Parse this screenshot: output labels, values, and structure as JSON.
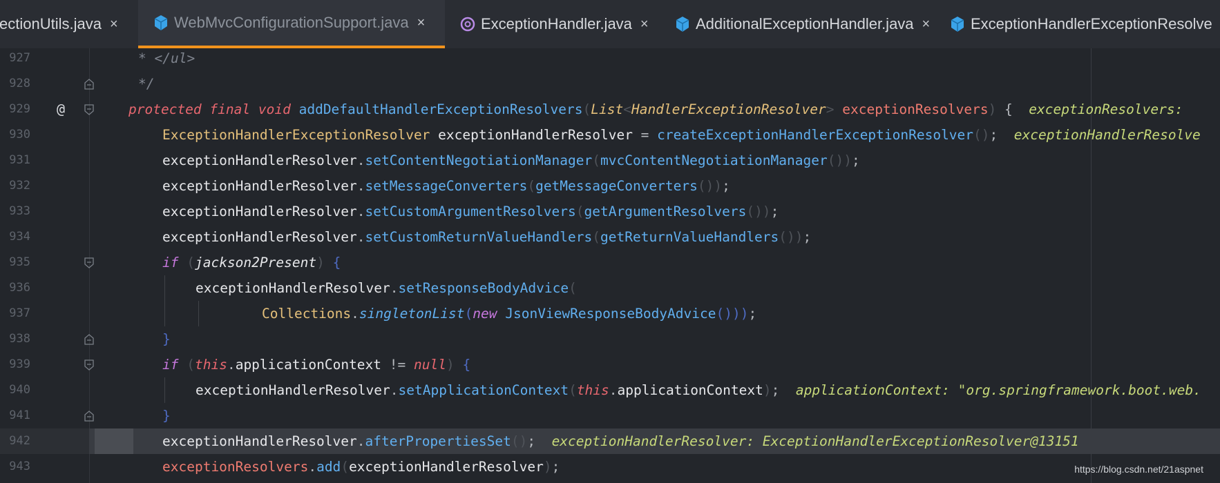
{
  "tabs": [
    {
      "label": "flectionUtils.java",
      "icon": "class-icon",
      "active": false,
      "close": "×"
    },
    {
      "label": "WebMvcConfigurationSupport.java",
      "icon": "class-icon",
      "active": true,
      "close": "×"
    },
    {
      "label": "ExceptionHandler.java",
      "icon": "annotation-icon",
      "active": false,
      "close": "×"
    },
    {
      "label": "AdditionalExceptionHandler.java",
      "icon": "class-icon",
      "active": false,
      "close": "×"
    },
    {
      "label": "ExceptionHandlerExceptionResolve",
      "icon": "class-icon",
      "active": false,
      "close": ""
    }
  ],
  "editor": {
    "lines": [
      {
        "num": "927",
        "tokens": [
          [
            "cm",
            "* </ul>"
          ]
        ]
      },
      {
        "num": "928",
        "tokens": [
          [
            "cm",
            "*/"
          ]
        ]
      },
      {
        "num": "929",
        "tokens": [
          [
            "kw",
            "protected"
          ],
          [
            "punc",
            " "
          ],
          [
            "kw",
            "final"
          ],
          [
            "punc",
            " "
          ],
          [
            "kw",
            "void"
          ],
          [
            "punc",
            " "
          ],
          [
            "fn",
            "addDefaultHandlerExceptionResolvers"
          ],
          [
            "paren",
            "("
          ],
          [
            "ty-it",
            "List"
          ],
          [
            "paren",
            "<"
          ],
          [
            "ty-it",
            "HandlerExceptionResolver"
          ],
          [
            "paren",
            ">"
          ],
          [
            "punc",
            " "
          ],
          [
            "param",
            "exceptionResolvers"
          ],
          [
            "paren",
            ")"
          ],
          [
            "punc",
            " {  "
          ],
          [
            "hint",
            "exceptionResolvers:"
          ]
        ]
      },
      {
        "num": "930",
        "tokens": [
          [
            "ty",
            "ExceptionHandlerExceptionResolver"
          ],
          [
            "punc",
            " "
          ],
          [
            "id",
            "exceptionHandlerResolver"
          ],
          [
            "punc",
            " = "
          ],
          [
            "fn",
            "createExceptionHandlerExceptionResolver"
          ],
          [
            "paren",
            "()"
          ],
          [
            "punc",
            ";  "
          ],
          [
            "hint",
            "exceptionHandlerResolve"
          ]
        ]
      },
      {
        "num": "931",
        "tokens": [
          [
            "id",
            "exceptionHandlerResolver"
          ],
          [
            "punc",
            "."
          ],
          [
            "fn",
            "setContentNegotiationManager"
          ],
          [
            "paren",
            "("
          ],
          [
            "fn",
            "mvcContentNegotiationManager"
          ],
          [
            "paren",
            "())"
          ],
          [
            "punc",
            ";"
          ]
        ]
      },
      {
        "num": "932",
        "tokens": [
          [
            "id",
            "exceptionHandlerResolver"
          ],
          [
            "punc",
            "."
          ],
          [
            "fn",
            "setMessageConverters"
          ],
          [
            "paren",
            "("
          ],
          [
            "fn",
            "getMessageConverters"
          ],
          [
            "paren",
            "())"
          ],
          [
            "punc",
            ";"
          ]
        ]
      },
      {
        "num": "933",
        "tokens": [
          [
            "id",
            "exceptionHandlerResolver"
          ],
          [
            "punc",
            "."
          ],
          [
            "fn",
            "setCustomArgumentResolvers"
          ],
          [
            "paren",
            "("
          ],
          [
            "fn",
            "getArgumentResolvers"
          ],
          [
            "paren",
            "())"
          ],
          [
            "punc",
            ";"
          ]
        ]
      },
      {
        "num": "934",
        "tokens": [
          [
            "id",
            "exceptionHandlerResolver"
          ],
          [
            "punc",
            "."
          ],
          [
            "fn",
            "setCustomReturnValueHandlers"
          ],
          [
            "paren",
            "("
          ],
          [
            "fn",
            "getReturnValueHandlers"
          ],
          [
            "paren",
            "())"
          ],
          [
            "punc",
            ";"
          ]
        ]
      },
      {
        "num": "935",
        "tokens": [
          [
            "kw2",
            "if"
          ],
          [
            "punc",
            " "
          ],
          [
            "paren",
            "("
          ],
          [
            "id-it",
            "jackson2Present"
          ],
          [
            "paren",
            ")"
          ],
          [
            "punc",
            " "
          ],
          [
            "paren-b",
            "{"
          ]
        ]
      },
      {
        "num": "936",
        "tokens": [
          [
            "id",
            "exceptionHandlerResolver"
          ],
          [
            "punc",
            "."
          ],
          [
            "fn",
            "setResponseBodyAdvice"
          ],
          [
            "paren",
            "("
          ]
        ]
      },
      {
        "num": "937",
        "tokens": [
          [
            "ty",
            "Collections"
          ],
          [
            "punc",
            "."
          ],
          [
            "fn-it",
            "singletonList"
          ],
          [
            "paren-b",
            "("
          ],
          [
            "kw2",
            "new"
          ],
          [
            "punc",
            " "
          ],
          [
            "fn",
            "JsonViewResponseBodyAdvice"
          ],
          [
            "paren-b",
            "()))"
          ],
          [
            "punc",
            ";"
          ]
        ]
      },
      {
        "num": "938",
        "tokens": [
          [
            "paren-b",
            "}"
          ]
        ]
      },
      {
        "num": "939",
        "tokens": [
          [
            "kw2",
            "if"
          ],
          [
            "punc",
            " "
          ],
          [
            "paren",
            "("
          ],
          [
            "kw",
            "this"
          ],
          [
            "punc",
            "."
          ],
          [
            "id",
            "applicationContext"
          ],
          [
            "punc",
            " != "
          ],
          [
            "kw",
            "null"
          ],
          [
            "paren",
            ")"
          ],
          [
            "punc",
            " "
          ],
          [
            "paren-b",
            "{"
          ]
        ]
      },
      {
        "num": "940",
        "tokens": [
          [
            "id",
            "exceptionHandlerResolver"
          ],
          [
            "punc",
            "."
          ],
          [
            "fn",
            "setApplicationContext"
          ],
          [
            "paren",
            "("
          ],
          [
            "kw",
            "this"
          ],
          [
            "punc",
            "."
          ],
          [
            "id",
            "applicationContext"
          ],
          [
            "paren",
            ")"
          ],
          [
            "punc",
            ";  "
          ],
          [
            "hint",
            "applicationContext: \"org.springframework.boot.web."
          ]
        ]
      },
      {
        "num": "941",
        "tokens": [
          [
            "paren-b",
            "}"
          ]
        ]
      },
      {
        "num": "942",
        "tokens": [
          [
            "id",
            "exceptionHandlerResolver"
          ],
          [
            "punc",
            "."
          ],
          [
            "fn",
            "afterPropertiesSet"
          ],
          [
            "paren",
            "()"
          ],
          [
            "punc",
            ";  "
          ],
          [
            "hint",
            "exceptionHandlerResolver: ExceptionHandlerExceptionResolver@13151"
          ]
        ]
      },
      {
        "num": "943",
        "tokens": [
          [
            "param",
            "exceptionResolvers"
          ],
          [
            "punc",
            "."
          ],
          [
            "fn",
            "add"
          ],
          [
            "paren",
            "("
          ],
          [
            "id",
            "exceptionHandlerResolver"
          ],
          [
            "paren",
            ")"
          ],
          [
            "punc",
            ";"
          ]
        ]
      }
    ],
    "current_line_index": 15,
    "override_marker": "@"
  },
  "watermark": "https://blog.csdn.net/21aspnet",
  "colors": {
    "background": "#23262b",
    "accent_tab_underline": "#f0921d",
    "current_line": "#393c42"
  }
}
